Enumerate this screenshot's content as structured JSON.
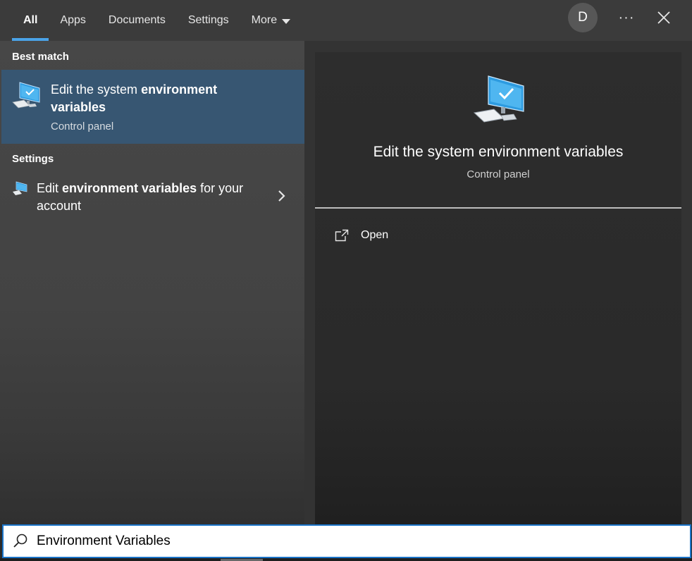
{
  "tabs": [
    {
      "label": "All",
      "active": true
    },
    {
      "label": "Apps",
      "active": false
    },
    {
      "label": "Documents",
      "active": false
    },
    {
      "label": "Settings",
      "active": false
    },
    {
      "label": "More",
      "active": false
    }
  ],
  "user": {
    "avatar_initial": "D"
  },
  "toolbar": {
    "more_options_label": "···"
  },
  "results": {
    "best_match": {
      "heading": "Best match",
      "title_prefix": "Edit the system ",
      "title_bold": "environment",
      "title_bold2": "variables",
      "subtitle": "Control panel",
      "icon": "monitor-check-icon",
      "selected": true
    },
    "settings": {
      "heading": "Settings",
      "items": [
        {
          "title_prefix": "Edit ",
          "title_bold": "environment variables",
          "title_suffix": " for your",
          "title_line2": "account",
          "icon": "monitor-settings-icon"
        }
      ]
    }
  },
  "detail": {
    "title": "Edit the system environment variables",
    "subtitle": "Control panel",
    "icon": "monitor-check-icon",
    "actions": [
      {
        "label": "Open",
        "icon": "open-external-icon"
      }
    ]
  },
  "search": {
    "value": "Environment Variables",
    "icon": "search-icon"
  },
  "colors": {
    "accent": "#4aa3e8",
    "selection": "#375672",
    "search_border": "#1a73c7"
  }
}
